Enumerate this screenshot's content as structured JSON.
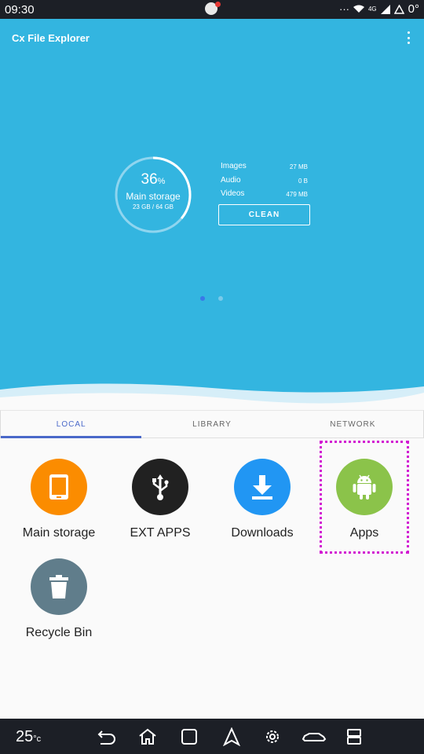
{
  "status_bar": {
    "time": "09:30",
    "signal_text": "4G",
    "temperature": "0°"
  },
  "header": {
    "app_title": "Cx File Explorer"
  },
  "storage": {
    "percent": "36",
    "percent_sign": "%",
    "percent_used": 36,
    "label": "Main storage",
    "size": "23 GB / 64 GB"
  },
  "stats": [
    {
      "label": "Images",
      "value": "27 MB"
    },
    {
      "label": "Audio",
      "value": "0 B"
    },
    {
      "label": "Videos",
      "value": "479 MB"
    }
  ],
  "clean_label": "CLEAN",
  "tabs": [
    {
      "label": "LOCAL",
      "active": true
    },
    {
      "label": "LIBRARY",
      "active": false
    },
    {
      "label": "NETWORK",
      "active": false
    }
  ],
  "items": [
    {
      "label": "Main storage",
      "color": "#fb8c00",
      "icon": "tablet-icon"
    },
    {
      "label": "EXT APPS",
      "color": "#212121",
      "icon": "usb-icon"
    },
    {
      "label": "Downloads",
      "color": "#2196f3",
      "icon": "download-icon"
    },
    {
      "label": "Apps",
      "color": "#8bc34a",
      "icon": "android-icon"
    },
    {
      "label": "Recycle Bin",
      "color": "#607d8b",
      "icon": "trash-icon"
    }
  ],
  "nav_bar": {
    "temperature": "25",
    "unit": "°c"
  }
}
